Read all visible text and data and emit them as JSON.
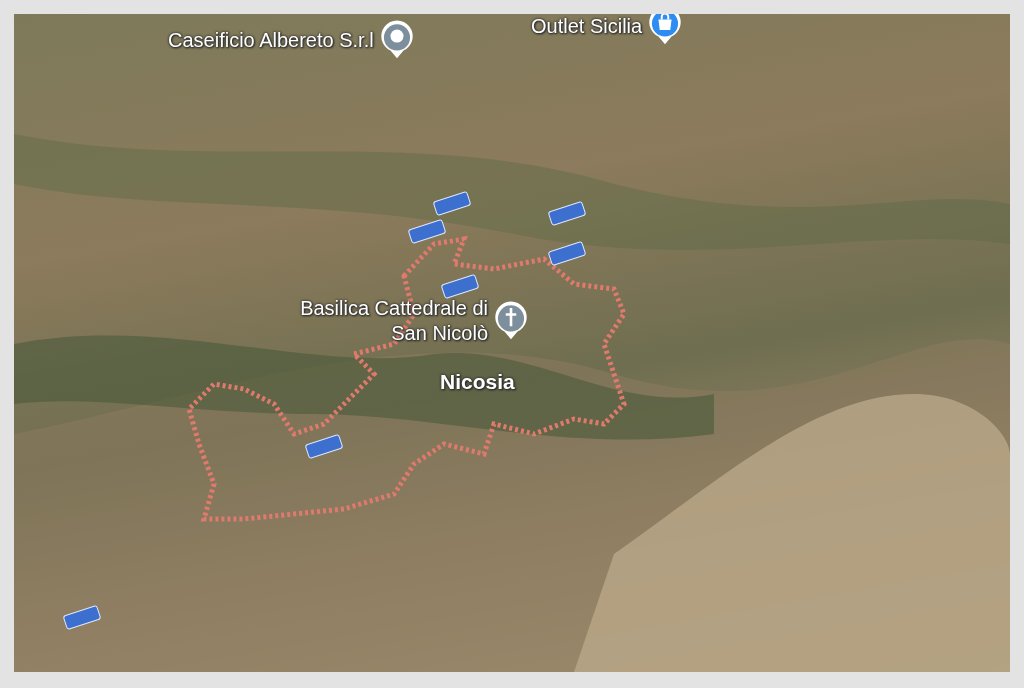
{
  "map": {
    "places": [
      {
        "kind": "place",
        "label": "Caseificio Albereto S.r.l"
      },
      {
        "kind": "shop",
        "label": "Outlet Sicilia"
      },
      {
        "kind": "church",
        "label": "Basilica Cattedrale di San Nicolò"
      },
      {
        "kind": "town",
        "label": "Nicosia"
      }
    ]
  }
}
